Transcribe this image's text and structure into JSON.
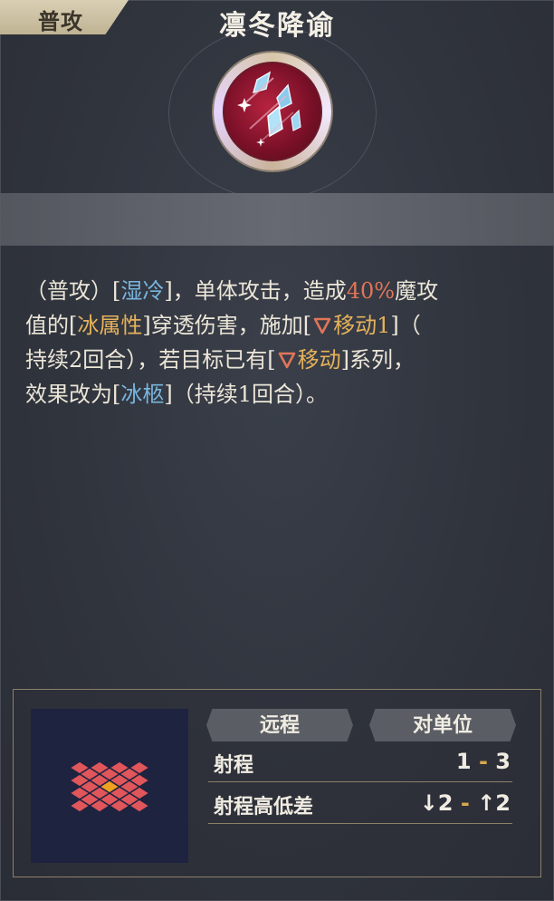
{
  "tag": {
    "label": "普攻"
  },
  "skill": {
    "icon": "ice-shard-icon",
    "name": "凛冬降谕"
  },
  "description": {
    "l1_a": "（普攻）[",
    "l1_kw1": "湿冷",
    "l1_b": "]，单体攻击，造成",
    "l1_pct": "40%",
    "l1_c": "魔攻",
    "l2_a": "值的[",
    "l2_kw": "冰属性",
    "l2_b": "]穿透伤害，施加[",
    "l2_debuff": "移动1",
    "l2_c": "]（",
    "l3_a": "持续2回合），若目标已有[",
    "l3_debuff": "移动",
    "l3_b": "]系列，",
    "l4_a": "效果改为[",
    "l4_kw": "冰柩",
    "l4_b": "]（持续1回合）。"
  },
  "attack_info": {
    "type_label": "远程",
    "target_label": "对单位",
    "range_label": "射程",
    "range_min": "1",
    "range_sep": "-",
    "range_max": "3",
    "height_label": "射程高低差",
    "height_down": "↓2",
    "height_up": "↑2"
  },
  "colors": {
    "keyword_blue": "#78b6de",
    "keyword_orange": "#e6b25a",
    "keyword_red": "#e07558",
    "grid_tile": "#e0565a",
    "grid_center": "#f0a020"
  }
}
